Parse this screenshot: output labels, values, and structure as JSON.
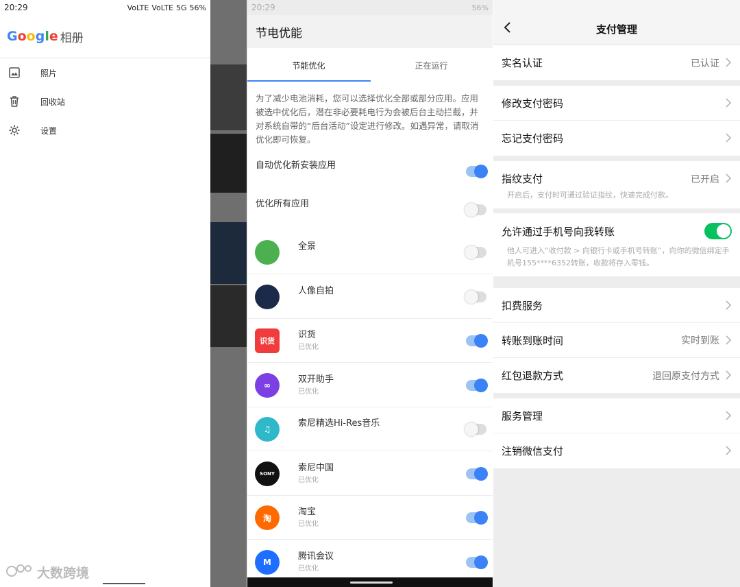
{
  "panel1": {
    "status": {
      "time": "20:29",
      "signal1": "VoLTE",
      "signal2": "VoLTE",
      "net": "5G",
      "battery": "56%"
    },
    "brand": {
      "google": [
        "G",
        "o",
        "o",
        "g",
        "l",
        "e"
      ],
      "google_colors": [
        "#4285F4",
        "#EA4335",
        "#FBBC05",
        "#4285F4",
        "#34A853",
        "#EA4335"
      ],
      "app": "相册"
    },
    "nav": [
      {
        "label": "照片",
        "icon": "photo-icon"
      },
      {
        "label": "回收站",
        "icon": "trash-icon"
      },
      {
        "label": "设置",
        "icon": "gear-icon"
      }
    ],
    "watermark": "大数跨境"
  },
  "panel2": {
    "status": {
      "time": "20:29",
      "battery": "56%"
    },
    "title": "节电优能",
    "tabs": [
      "节能优化",
      "正在运行"
    ],
    "description": "为了减少电池消耗，您可以选择优化全部或部分应用。应用被选中优化后，潜在非必要耗电行为会被后台主动拦截，并对系统自带的“后台活动”设定进行修改。如遇异常，请取消优化即可恢复。",
    "options": [
      {
        "label": "自动优化新安装应用",
        "on": true
      },
      {
        "label": "优化所有应用",
        "on": false
      }
    ],
    "apps": [
      {
        "name": "全景",
        "status": "",
        "on": false,
        "icon_color": "#4caf50",
        "icon_text": ""
      },
      {
        "name": "人像自拍",
        "status": "",
        "on": false,
        "icon_color": "#1a2a48",
        "icon_text": ""
      },
      {
        "name": "识货",
        "status": "已优化",
        "on": true,
        "icon_color": "#f03c3c",
        "icon_text": "识货"
      },
      {
        "name": "双开助手",
        "status": "已优化",
        "on": true,
        "icon_color": "#7b3fe4",
        "icon_text": "∞"
      },
      {
        "name": "索尼精选Hi-Res音乐",
        "status": "",
        "on": false,
        "icon_color": "#2eb8c9",
        "icon_text": "♫"
      },
      {
        "name": "索尼中国",
        "status": "已优化",
        "on": true,
        "icon_color": "#111111",
        "icon_text": "SONY"
      },
      {
        "name": "淘宝",
        "status": "已优化",
        "on": true,
        "icon_color": "#ff6a00",
        "icon_text": "淘"
      },
      {
        "name": "腾讯会议",
        "status": "已优化",
        "on": true,
        "icon_color": "#1e6fff",
        "icon_text": "M"
      }
    ]
  },
  "panel3": {
    "title": "支付管理",
    "groups": [
      {
        "cells": [
          {
            "label": "实名认证",
            "value": "已认证"
          }
        ]
      },
      {
        "cells": [
          {
            "label": "修改支付密码",
            "value": ""
          },
          {
            "label": "忘记支付密码",
            "value": ""
          }
        ]
      },
      {
        "cells": [
          {
            "label": "指纹支付",
            "value": "已开启"
          }
        ],
        "note": "开启后，支付时可通过验证指纹，快速完成付款。"
      },
      {
        "cells": [
          {
            "label": "允许通过手机号向我转账",
            "value": "",
            "toggle": true
          }
        ],
        "note": "他人可进入“收付款 > 向银行卡或手机号转账”，向你的微信绑定手机号155****6352转账，收款将存入零钱。"
      },
      {
        "cells": [
          {
            "label": "扣费服务",
            "value": ""
          },
          {
            "label": "转账到账时间",
            "value": "实时到账"
          },
          {
            "label": "红包退款方式",
            "value": "退回原支付方式"
          }
        ]
      },
      {
        "cells": [
          {
            "label": "服务管理",
            "value": ""
          },
          {
            "label": "注销微信支付",
            "value": ""
          }
        ]
      }
    ]
  }
}
